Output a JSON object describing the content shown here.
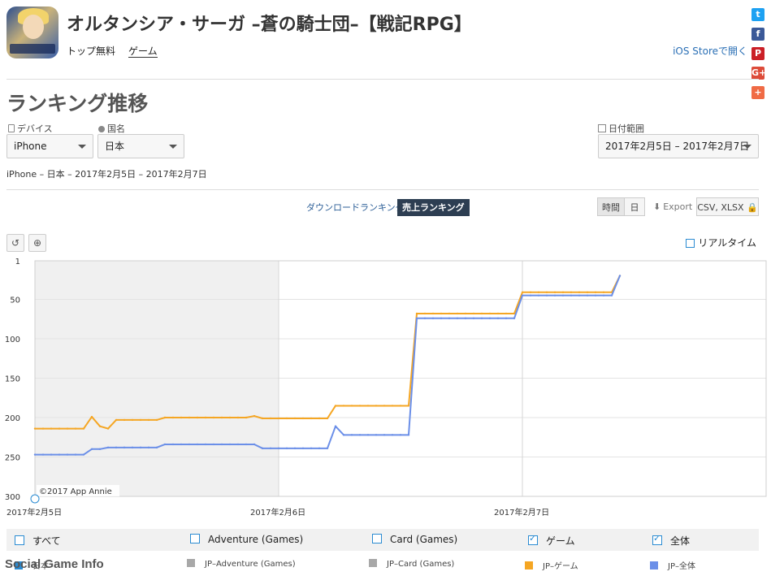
{
  "app": {
    "title": "オルタンシア・サーガ –蒼の騎士団–【戦記RPG】",
    "category_main": "トップ無料",
    "category_sub": "ゲーム",
    "store_link": "iOS Storeで開く"
  },
  "social": [
    {
      "icon": "twitter-icon",
      "glyph": "t",
      "color": "#1da1f2"
    },
    {
      "icon": "facebook-icon",
      "glyph": "f",
      "color": "#3b5998"
    },
    {
      "icon": "pinterest-icon",
      "glyph": "P",
      "color": "#cb2027"
    },
    {
      "icon": "googleplus-icon",
      "glyph": "G+",
      "color": "#dd4b39"
    },
    {
      "icon": "share-plus-icon",
      "glyph": "+",
      "color": "#f06b45"
    }
  ],
  "page": {
    "title": "ランキング推移",
    "device_label": "デバイス",
    "device_value": "iPhone",
    "country_label": "国名",
    "country_value": "日本",
    "date_label": "日付範囲",
    "date_value": "2017年2月5日 – 2017年2月7日",
    "summary": "iPhone – 日本 – 2017年2月5日 – 2017年2月7日"
  },
  "tabs": {
    "download": "ダウンロードランキング",
    "revenue": "売上ランキング"
  },
  "toolbar": {
    "hour": "時間",
    "day": "日",
    "export": "Export",
    "csv": "CSV, XLSX",
    "realtime": "リアルタイム"
  },
  "chart_data": {
    "type": "line",
    "y_inverted": true,
    "ylim": [
      1,
      300
    ],
    "y_ticks": [
      "1",
      "50",
      "100",
      "150",
      "200",
      "250",
      "300"
    ],
    "x_ticks": [
      "2017年2月5日",
      "2017年2月6日",
      "2017年2月7日"
    ],
    "credit": "©2017 App Annie",
    "shaded_region": "2017年2月5日 – 2017年2月6日",
    "series": [
      {
        "name": "JP-ゲーム",
        "color": "#f5a623",
        "x": [
          0,
          1,
          2,
          3,
          4,
          5,
          6,
          7,
          8,
          9,
          10,
          11,
          12,
          13,
          14,
          15,
          16,
          17,
          18,
          19,
          20,
          21,
          22,
          23,
          24,
          25,
          26,
          27,
          28,
          29,
          30,
          31,
          32,
          33,
          34,
          35,
          36,
          37,
          38,
          39,
          40,
          41,
          42,
          43,
          44,
          45,
          46,
          47,
          48,
          49,
          50,
          51,
          52,
          53,
          54,
          55,
          56,
          57,
          58,
          59,
          60,
          61,
          62,
          63,
          64,
          65,
          66,
          67,
          68,
          69,
          70,
          71,
          72
        ],
        "values": [
          214,
          214,
          214,
          214,
          214,
          214,
          214,
          199,
          211,
          214,
          203,
          203,
          203,
          203,
          203,
          203,
          200,
          200,
          200,
          200,
          200,
          200,
          200,
          200,
          200,
          200,
          200,
          198,
          201,
          201,
          201,
          201,
          201,
          201,
          201,
          201,
          201,
          185,
          185,
          185,
          185,
          185,
          185,
          185,
          185,
          185,
          185,
          68,
          68,
          68,
          68,
          68,
          68,
          68,
          68,
          68,
          68,
          68,
          68,
          68,
          41,
          41,
          41,
          41,
          41,
          41,
          41,
          41,
          41,
          41,
          41,
          41,
          20
        ]
      },
      {
        "name": "JP-全体",
        "color": "#6b8fe8",
        "x": [
          0,
          1,
          2,
          3,
          4,
          5,
          6,
          7,
          8,
          9,
          10,
          11,
          12,
          13,
          14,
          15,
          16,
          17,
          18,
          19,
          20,
          21,
          22,
          23,
          24,
          25,
          26,
          27,
          28,
          29,
          30,
          31,
          32,
          33,
          34,
          35,
          36,
          37,
          38,
          39,
          40,
          41,
          42,
          43,
          44,
          45,
          46,
          47,
          48,
          49,
          50,
          51,
          52,
          53,
          54,
          55,
          56,
          57,
          58,
          59,
          60,
          61,
          62,
          63,
          64,
          65,
          66,
          67,
          68,
          69,
          70,
          71,
          72
        ],
        "values": [
          247,
          247,
          247,
          247,
          247,
          247,
          247,
          240,
          240,
          238,
          238,
          238,
          238,
          238,
          238,
          238,
          234,
          234,
          234,
          234,
          234,
          234,
          234,
          234,
          234,
          234,
          234,
          234,
          239,
          239,
          239,
          239,
          239,
          239,
          239,
          239,
          239,
          211,
          222,
          222,
          222,
          222,
          222,
          222,
          222,
          222,
          222,
          74,
          74,
          74,
          74,
          74,
          74,
          74,
          74,
          74,
          74,
          74,
          74,
          74,
          45,
          45,
          45,
          45,
          45,
          45,
          45,
          45,
          45,
          45,
          45,
          45,
          20
        ]
      }
    ]
  },
  "legend": {
    "row1": [
      {
        "label": "すべて",
        "checked": false
      },
      {
        "label": "Adventure (Games)",
        "checked": false
      },
      {
        "label": "Card (Games)",
        "checked": false
      },
      {
        "label": "ゲーム",
        "checked": true
      },
      {
        "label": "全体",
        "checked": true
      }
    ],
    "row2": [
      {
        "label": "日本",
        "color": "#2a8bd2"
      },
      {
        "label": "JP–Adventure (Games)",
        "color": "#a8a8a8"
      },
      {
        "label": "JP–Card (Games)",
        "color": "#a8a8a8"
      },
      {
        "label": "JP–ゲーム",
        "color": "#f5a623"
      },
      {
        "label": "JP–全体",
        "color": "#6b8fe8"
      }
    ]
  },
  "watermark": "Social Game Info"
}
